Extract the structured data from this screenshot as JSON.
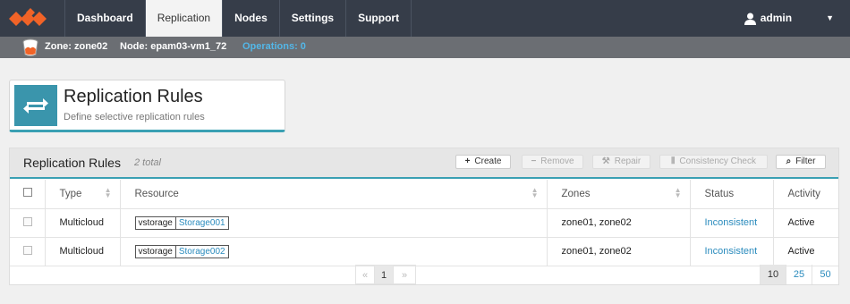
{
  "nav": {
    "items": [
      {
        "label": "Dashboard"
      },
      {
        "label": "Replication"
      },
      {
        "label": "Nodes"
      },
      {
        "label": "Settings"
      },
      {
        "label": "Support"
      }
    ],
    "active": "Replication",
    "user": "admin",
    "caret": "▼"
  },
  "subbar": {
    "zone": "Zone: zone02",
    "node": "Node: epam03-vm1_72",
    "operations": "Operations: 0"
  },
  "header": {
    "title": "Replication Rules",
    "subtitle": "Define selective replication rules"
  },
  "panel": {
    "title": "Replication Rules",
    "total": "2 total",
    "buttons": {
      "create": "Create",
      "remove": "Remove",
      "repair": "Repair",
      "consistency": "Consistency Check",
      "filter": "Filter"
    }
  },
  "table": {
    "columns": {
      "type": "Type",
      "resource": "Resource",
      "zones": "Zones",
      "status": "Status",
      "activity": "Activity"
    },
    "rows": [
      {
        "type": "Multicloud",
        "resource_type": "vstorage",
        "resource_name": "Storage001",
        "zones": "zone01, zone02",
        "status": "Inconsistent",
        "activity": "Active"
      },
      {
        "type": "Multicloud",
        "resource_type": "vstorage",
        "resource_name": "Storage002",
        "zones": "zone01, zone02",
        "status": "Inconsistent",
        "activity": "Active"
      }
    ]
  },
  "pagination": {
    "prev": "«",
    "current": "1",
    "next": "»",
    "sizes": [
      "10",
      "25",
      "50"
    ],
    "active_size": "10"
  },
  "colors": {
    "navbar": "#363d49",
    "accent": "#3aa0b3",
    "link": "#2a8bbd",
    "logo": "#f16327"
  }
}
